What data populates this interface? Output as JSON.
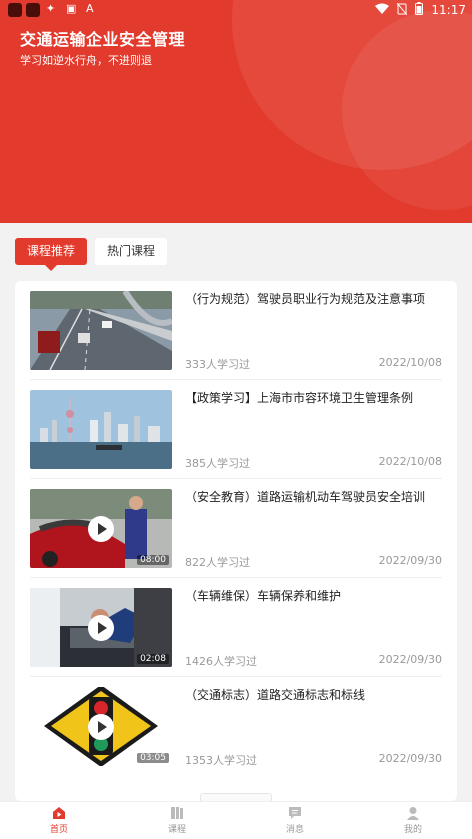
{
  "status_bar": {
    "time": "11:17"
  },
  "header": {
    "title": "交通运输企业安全管理",
    "subtitle": "学习如逆水行舟，不进则退"
  },
  "tabs": [
    {
      "label": "课程推荐",
      "active": true
    },
    {
      "label": "热门课程",
      "active": false
    }
  ],
  "courses": [
    {
      "title": "（行为规范）驾驶员职业行为规范及注意事项",
      "learners": "333人学习过",
      "date": "2022/10/08",
      "duration": "",
      "thumb": "highway"
    },
    {
      "title": "【政策学习】上海市市容环境卫生管理条例",
      "learners": "385人学习过",
      "date": "2022/10/08",
      "duration": "",
      "thumb": "skyline"
    },
    {
      "title": "（安全教育）道路运输机动车驾驶员安全培训",
      "learners": "822人学习过",
      "date": "2022/09/30",
      "duration": "08:00",
      "thumb": "car"
    },
    {
      "title": "（车辆维保）车辆保养和维护",
      "learners": "1426人学习过",
      "date": "2022/09/30",
      "duration": "02:08",
      "thumb": "engine"
    },
    {
      "title": "（交通标志）道路交通标志和标线",
      "learners": "1353人学习过",
      "date": "2022/09/30",
      "duration": "03:05",
      "thumb": "sign"
    }
  ],
  "nav": [
    {
      "label": "首页",
      "icon": "home-icon",
      "active": true
    },
    {
      "label": "课程",
      "icon": "book-icon",
      "active": false
    },
    {
      "label": "消息",
      "icon": "message-icon",
      "active": false
    },
    {
      "label": "我的",
      "icon": "user-icon",
      "active": false
    }
  ],
  "colors": {
    "accent": "#e23a2c"
  }
}
